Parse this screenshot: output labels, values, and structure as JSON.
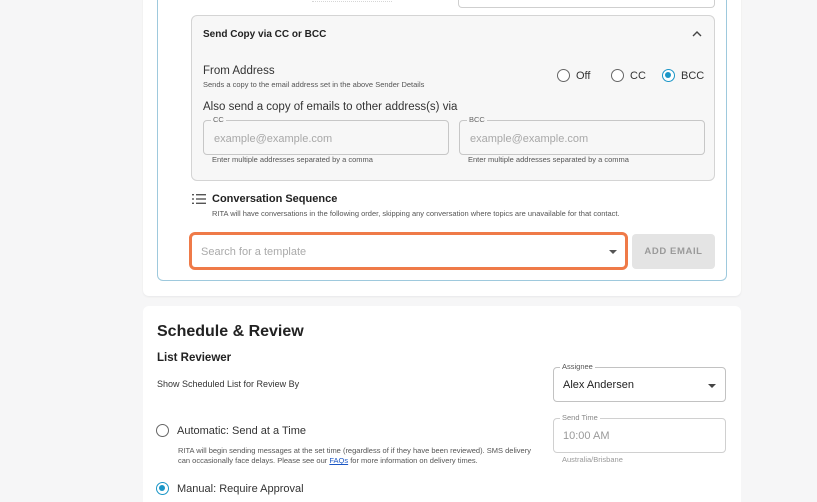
{
  "cc_section": {
    "title": "Send Copy via CC or BCC",
    "from_label": "From Address",
    "from_sub": "Sends a copy to the email address set in the above Sender Details",
    "options": [
      "Off",
      "CC",
      "BCC"
    ],
    "selected": "BCC",
    "also_label": "Also send a copy of emails to other address(s) via",
    "cc": {
      "legend": "CC",
      "placeholder": "example@example.com",
      "helper": "Enter multiple addresses separated by a comma"
    },
    "bcc": {
      "legend": "BCC",
      "placeholder": "example@example.com",
      "helper": "Enter multiple addresses separated by a comma"
    }
  },
  "sequence": {
    "title": "Conversation Sequence",
    "subtitle": "RITA will have conversations in the following order, skipping any conversation where topics are unavailable for that contact.",
    "search_placeholder": "Search for a template",
    "add_email_label": "ADD EMAIL"
  },
  "schedule": {
    "title": "Schedule & Review",
    "list_reviewer": "List Reviewer",
    "show_scheduled": "Show Scheduled List for Review By",
    "assignee": {
      "legend": "Assignee",
      "value": "Alex Andersen"
    },
    "send_time": {
      "legend": "Send Time",
      "value": "10:00 AM",
      "timezone": "Australia/Brisbane"
    },
    "automatic": {
      "label": "Automatic: Send at a Time",
      "desc_before": "RITA will begin sending messages at the set time (regardless of if they have been reviewed). SMS delivery can occasionally face delays. Please see our ",
      "link": "FAQs",
      "desc_after": " for more information on delivery times."
    },
    "manual": {
      "label": "Manual: Require Approval"
    },
    "selected": "manual"
  },
  "colors": {
    "accent": "#1b96c7",
    "highlight": "#ef7a48",
    "link": "#1a56c4"
  }
}
